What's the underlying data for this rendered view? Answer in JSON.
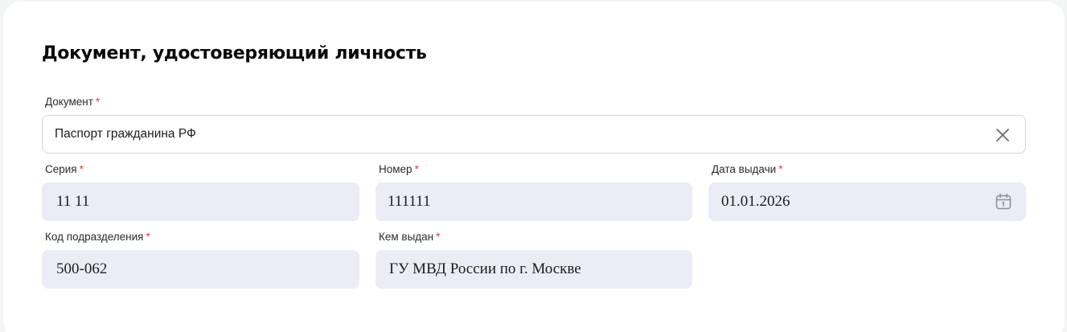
{
  "section": {
    "title": "Документ, удостоверяющий личность"
  },
  "required_mark": "*",
  "document": {
    "label": "Документ",
    "value": "Паспорт гражданина РФ",
    "clear_icon": "close-icon"
  },
  "series": {
    "label": "Серия",
    "value": "11 11"
  },
  "number": {
    "label": "Номер",
    "value": "111111"
  },
  "issue_date": {
    "label": "Дата выдачи",
    "value": "01.01.2026",
    "icon": "calendar-icon"
  },
  "division_code": {
    "label": "Код подразделения",
    "value": "500-062"
  },
  "issued_by": {
    "label": "Кем выдан",
    "value": "ГУ МВД России по г. Москве"
  },
  "colors": {
    "required": "#e5383b",
    "field_background": "#ebecf5",
    "card_background": "#ffffff",
    "page_background": "#f3f4f6"
  }
}
